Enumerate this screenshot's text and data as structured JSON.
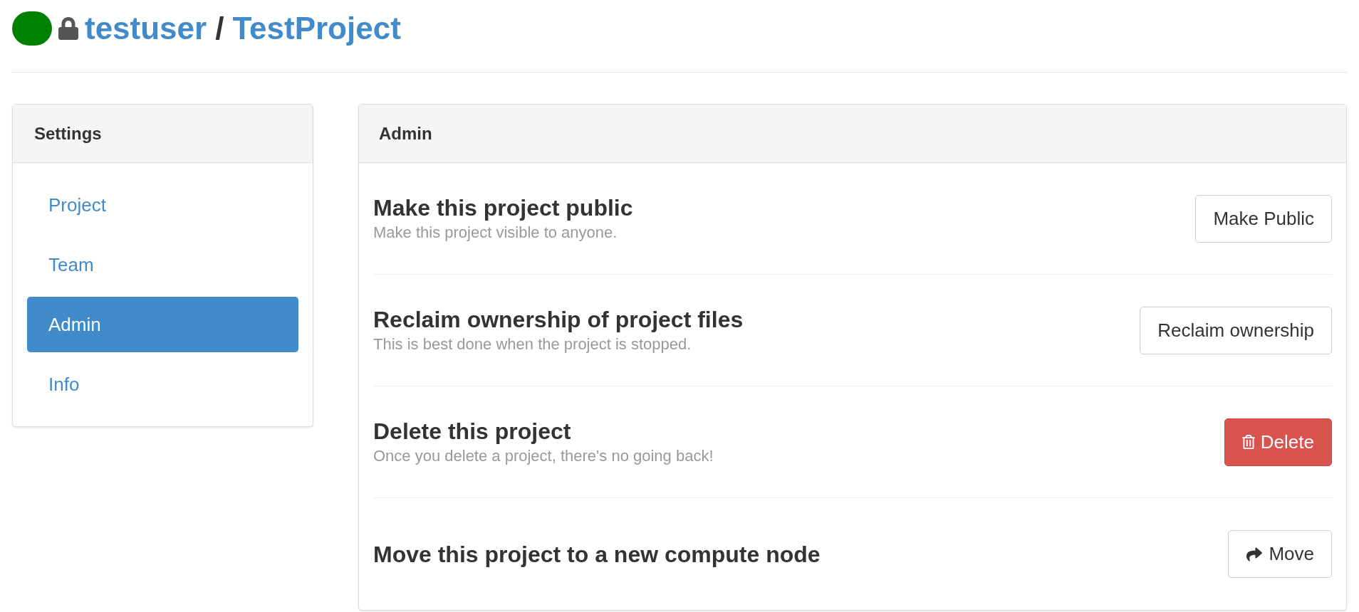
{
  "header": {
    "owner": "testuser",
    "separator": "/",
    "project": "TestProject"
  },
  "sidebar": {
    "title": "Settings",
    "items": [
      {
        "label": "Project",
        "selected": false
      },
      {
        "label": "Team",
        "selected": false
      },
      {
        "label": "Admin",
        "selected": true
      },
      {
        "label": "Info",
        "selected": false
      }
    ]
  },
  "panel": {
    "title": "Admin",
    "rows": [
      {
        "title": "Make this project public",
        "description": "Make this project visible to anyone.",
        "button": {
          "label": "Make Public",
          "kind": "plain"
        }
      },
      {
        "title": "Reclaim ownership of project files",
        "description": "This is best done when the project is stopped.",
        "button": {
          "label": "Reclaim ownership",
          "kind": "plain"
        }
      },
      {
        "title": "Delete this project",
        "description": "Once you delete a project, there's no going back!",
        "button": {
          "label": "Delete",
          "kind": "delete"
        }
      },
      {
        "title": "Move this project to a new compute node",
        "button": {
          "label": "Move",
          "kind": "move"
        }
      }
    ]
  }
}
